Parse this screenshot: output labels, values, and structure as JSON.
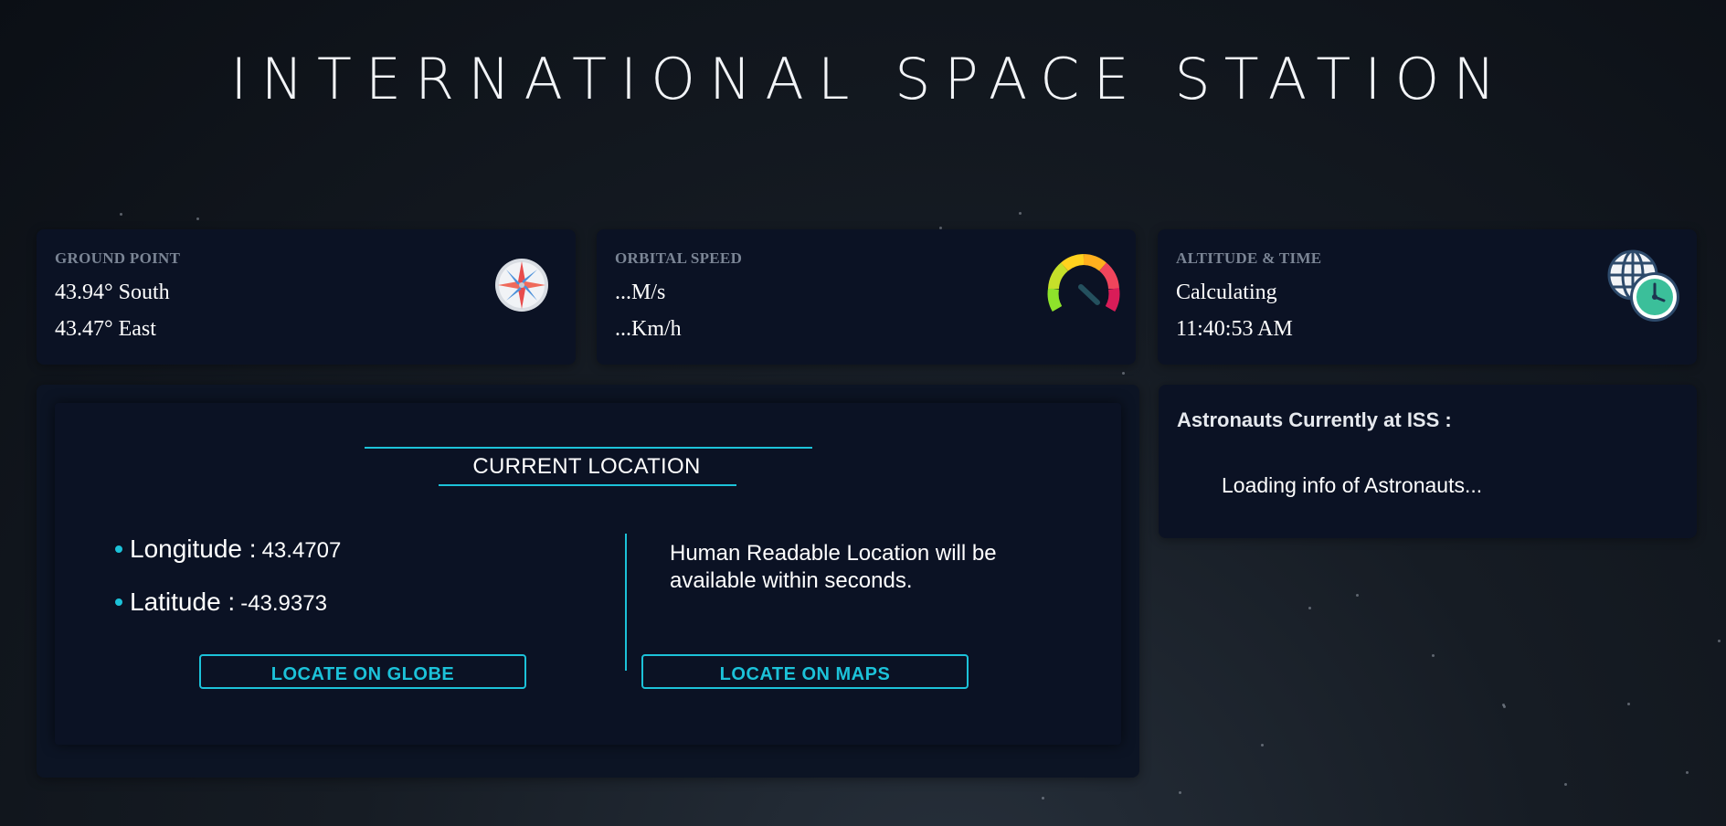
{
  "page": {
    "title": "INTERNATIONAL SPACE STATION"
  },
  "ground_point": {
    "label": "GROUND POINT",
    "latitude_text": "43.94° South",
    "longitude_text": "43.47° East",
    "icon": "compass-icon"
  },
  "orbital_speed": {
    "label": "ORBITAL SPEED",
    "speed_ms": "...M/s",
    "speed_kmh": "...Km/h",
    "icon": "speedometer-icon"
  },
  "altitude_time": {
    "label": "ALTITUDE & TIME",
    "altitude": "Calculating",
    "time": "11:40:53 AM",
    "icon": "globe-clock-icon"
  },
  "current_location": {
    "heading": "CURRENT LOCATION",
    "longitude_label": "Longitude :",
    "longitude_value": "43.4707",
    "latitude_label": "Latitude :",
    "latitude_value": "-43.9373",
    "readable_text": "Human Readable Location will be available within seconds.",
    "globe_button": "LOCATE ON GLOBE",
    "maps_button": "LOCATE ON MAPS"
  },
  "astronauts": {
    "title": "Astronauts Currently at ISS :",
    "loading": "Loading info of Astronauts..."
  },
  "colors": {
    "accent": "#1cc2d9",
    "card_bg": "#0b1224",
    "label_gray": "#7b8595"
  }
}
